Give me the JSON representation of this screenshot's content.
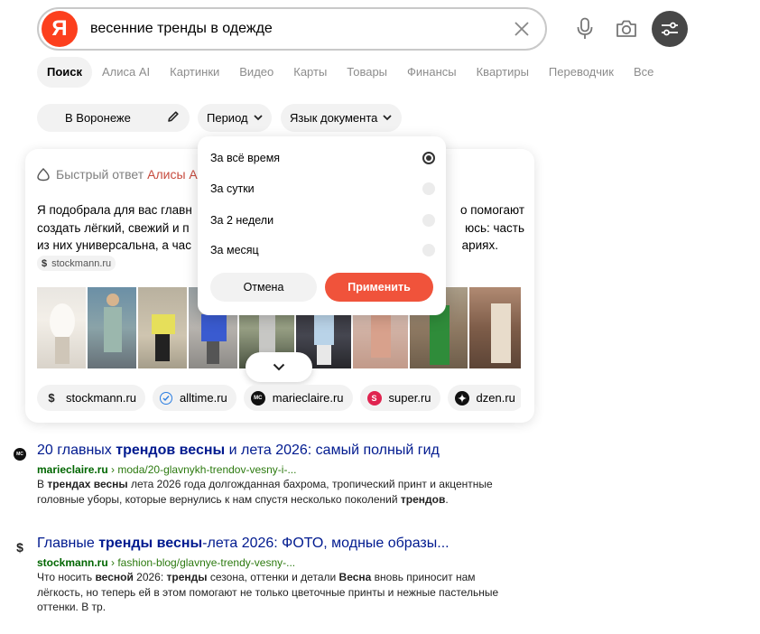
{
  "search": {
    "logo": "Я",
    "query": "весенние тренды в одежде"
  },
  "tabs": [
    "Поиск",
    "Алиса AI",
    "Картинки",
    "Видео",
    "Карты",
    "Товары",
    "Финансы",
    "Квартиры",
    "Переводчик",
    "Все"
  ],
  "filters": {
    "region": "В Воронеже",
    "period": "Период",
    "language": "Язык документа"
  },
  "period_dropdown": {
    "options": [
      "За всё время",
      "За сутки",
      "За 2 недели",
      "За месяц"
    ],
    "selected_index": 0,
    "cancel": "Отмена",
    "apply": "Применить"
  },
  "alice": {
    "title_prefix": "Быстрый ответ",
    "title_accent": "Алисы А",
    "text_line1_left": "Я подобрала для вас главн",
    "text_line1_right": "о помогают",
    "text_line2_left": "создать лёгкий, свежий и п",
    "text_line2_right": "юсь: часть",
    "text_line3_left": "из них универсальна, а час",
    "text_line3_right": "ариях.",
    "source": "stockmann.ru",
    "sources": [
      "stockmann.ru",
      "alltime.ru",
      "marieclaire.ru",
      "super.ru",
      "dzen.ru"
    ]
  },
  "results": [
    {
      "title_pre": "20 главных ",
      "title_bold": "трендов весны",
      "title_post": " и лета 2026: самый полный гид",
      "domain": "marieclaire.ru",
      "path": " › moda/20-glavnykh-trendov-vesny-i-...",
      "s1": "В ",
      "s1b": "трендах весны",
      "s2": " лета 2026 года долгожданная бахрома, тропический принт и акцентные",
      "s3": "головные уборы, которые вернулись к нам спустя несколько поколений ",
      "s3b": "трендов",
      "s3e": "."
    },
    {
      "title_pre": "Главные ",
      "title_bold": "тренды весны",
      "title_post": "-лета 2026: ФОТО, модные образы...",
      "domain": "stockmann.ru",
      "path": " › fashion-blog/glavnye-trendy-vesny-...",
      "s1": "Что носить ",
      "s1b": "весной",
      "s2": " 2026: ",
      "s2b": "тренды",
      "s3": " сезона, оттенки и детали ",
      "s3b": "Весна",
      "s3e": " вновь приносит нам",
      "s4": "лёгкость, но теперь ей в этом помогают не только цветочные принты и нежные пастельные",
      "s5": "оттенки. В тр."
    }
  ]
}
